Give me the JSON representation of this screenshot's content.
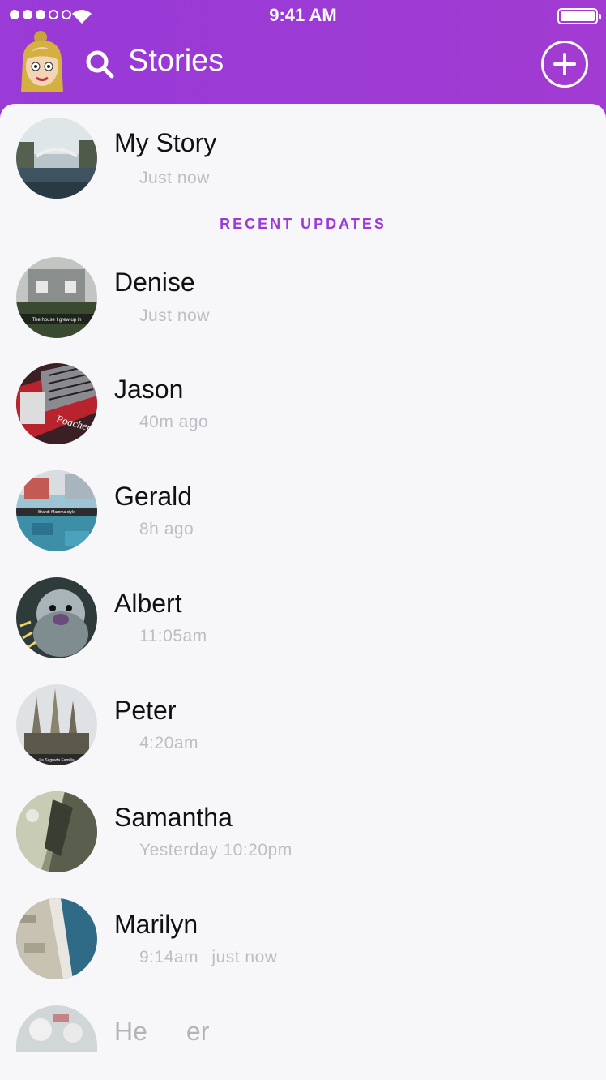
{
  "status_bar": {
    "time": "9:41 AM"
  },
  "header": {
    "title": "Stories"
  },
  "my_story": {
    "name": "My Story",
    "time": "Just now"
  },
  "section": {
    "label": "RECENT UPDATES"
  },
  "stories": [
    {
      "name": "Denise",
      "time": "Just now"
    },
    {
      "name": "Jason",
      "time": "40m ago"
    },
    {
      "name": "Gerald",
      "time": "8h ago"
    },
    {
      "name": "Albert",
      "time": "11:05am"
    },
    {
      "name": "Peter",
      "time": "4:20am"
    },
    {
      "name": "Samantha",
      "time": "Yesterday 10:20pm"
    },
    {
      "name": "Marilyn",
      "time": "9:14am",
      "time2": "just now"
    },
    {
      "name": "He",
      "name2": "er"
    }
  ],
  "thumb_captions": {
    "denise": "The house I grew up in",
    "jason": "Poacher",
    "gerald": "Brand: Mamma style",
    "peter": "La Sagrada Familia"
  },
  "colors": {
    "accent": "#9a3ad7",
    "header_end": "#a23bd1",
    "name_text": "#111111",
    "subtext": "#bdbdc2"
  }
}
